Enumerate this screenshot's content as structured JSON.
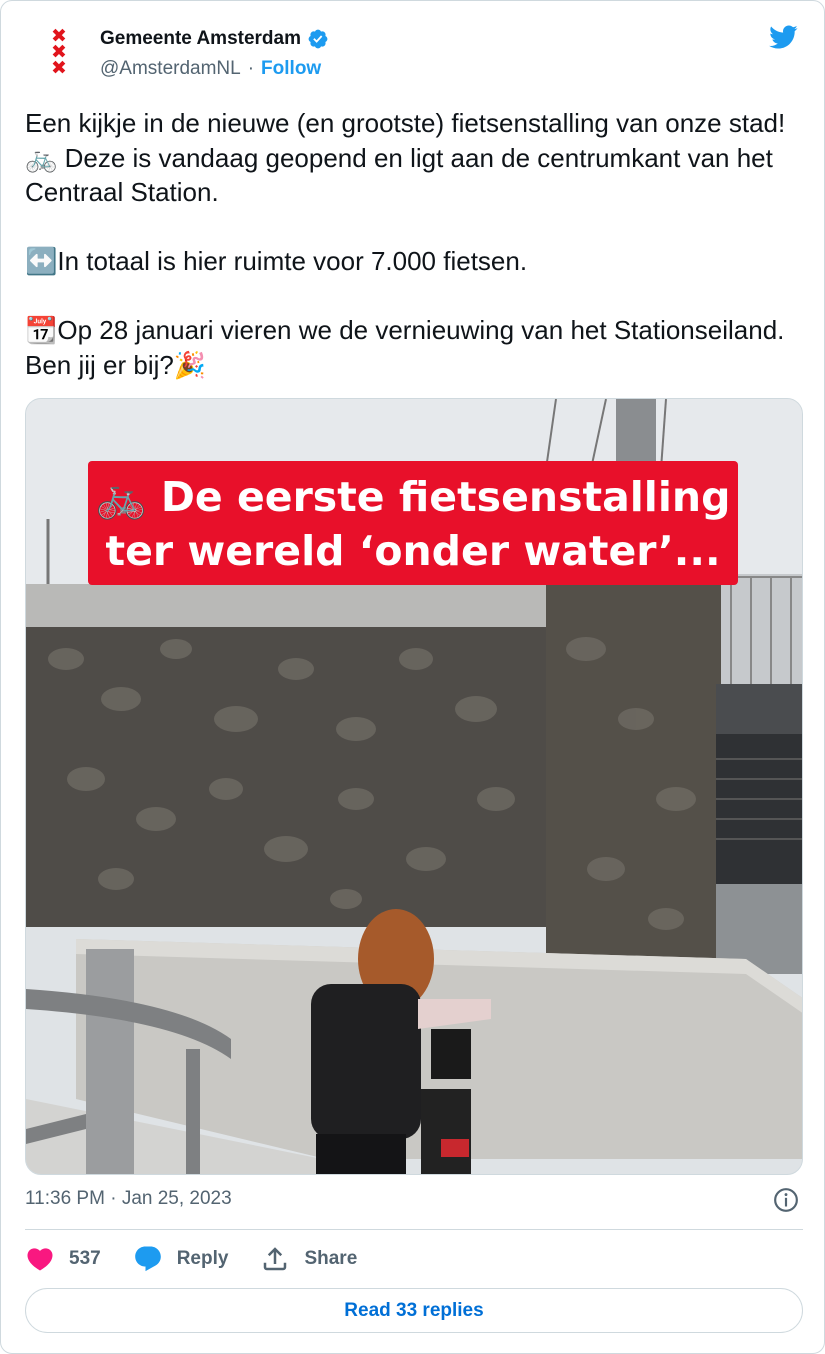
{
  "account": {
    "name": "Gemeente Amsterdam",
    "handle": "@AmsterdamNL",
    "separator": "·",
    "follow_label": "Follow",
    "verified": true
  },
  "tweet": {
    "para1": "Een kijkje in de nieuwe (en grootste) fietsenstalling van onze stad! 🚲 Deze is vandaag geopend en ligt aan de centrumkant van het Centraal Station.",
    "para2": "↔️In totaal is hier ruimte voor 7.000 fietsen.",
    "para3": "📆Op 28 januari vieren we de vernieuwing van het Stationseiland. Ben jij er bij?🎉"
  },
  "media": {
    "caption_line1": "🚲 De eerste fietsenstalling",
    "caption_line2": "ter wereld ‘onder water’..."
  },
  "meta": {
    "time": "11:36 PM",
    "separator": " · ",
    "date": "Jan 25, 2023"
  },
  "actions": {
    "like_count": "537",
    "reply_label": "Reply",
    "share_label": "Share",
    "read_replies_label": "Read 33 replies"
  },
  "colors": {
    "brand_blue": "#1d9bf0",
    "like_pink": "#f91880",
    "caption_red": "#e8102a",
    "amsterdam_red": "#e1141c"
  },
  "icons": [
    "amsterdam-logo-icon",
    "verified-badge-icon",
    "twitter-bird-icon",
    "info-icon",
    "heart-icon",
    "reply-bubble-icon",
    "share-icon"
  ]
}
